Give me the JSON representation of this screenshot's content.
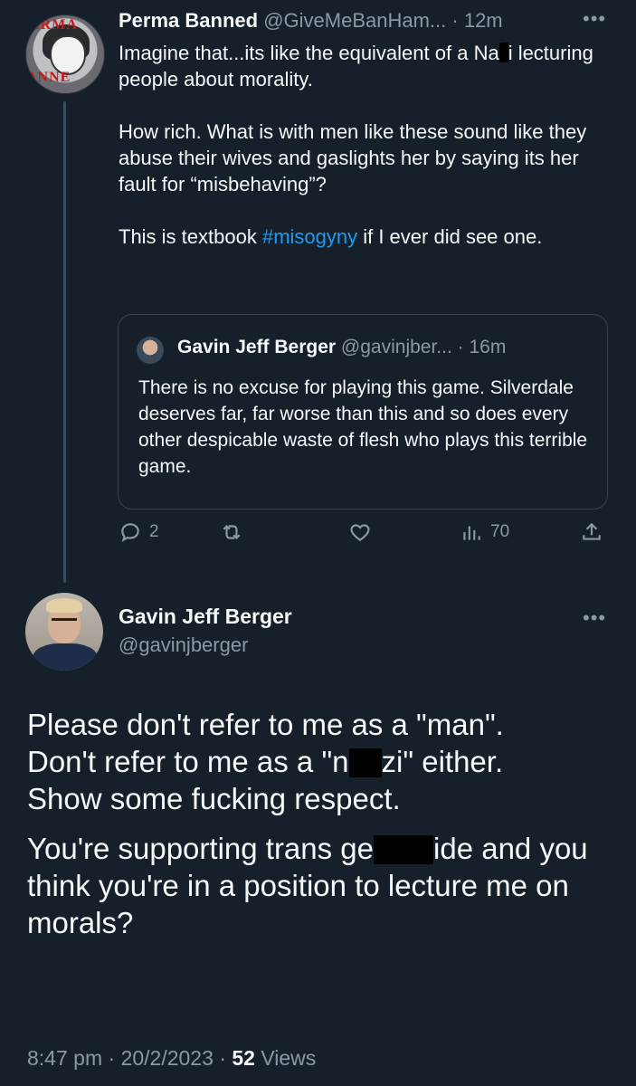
{
  "parent_tweet": {
    "display_name": "Perma Banned",
    "handle": "@GiveMeBanHam...",
    "separator": "·",
    "time": "12m",
    "more_icon": "more-horizontal-icon",
    "avatar_banner_top": "ERMA",
    "avatar_banner_bottom": "ANNE",
    "text_p1_before": "Imagine that...its like the equivalent of a Na",
    "text_p1_after": "i lecturing people about morality.",
    "text_p2": "How rich. What is with men like these sound like they abuse their wives and gaslights her by saying its her fault for “misbehaving”?",
    "text_p3_before": "This is textbook ",
    "hashtag": "#misogyny",
    "text_p3_after": " if I ever did see one."
  },
  "quoted_tweet": {
    "display_name": "Gavin Jeff Berger",
    "handle": "@gavinjber...",
    "separator": "·",
    "time": "16m",
    "text": "There is no excuse for playing this game. Silverdale deserves far, far worse than this and so does every other despicable waste of flesh who plays this terrible game."
  },
  "actions": {
    "reply_count": "2",
    "retweet_count": "",
    "like_count": "",
    "views_count": "70"
  },
  "main_tweet": {
    "display_name": "Gavin Jeff Berger",
    "handle": "@gavinjberger",
    "p1_line1": "Please don't refer to me as a \"man\".",
    "p1_line2_before": "Don't refer to me as a \"n",
    "p1_line2_after": "zi\" either.",
    "p1_line3": "Show some fucking respect.",
    "p2_before": "You're supporting trans ge",
    "p2_after": "ide and you think you're in a position to lecture me on morals?",
    "time": "8:47 pm",
    "date": "20/2/2023",
    "separator": "·",
    "views_count": "52",
    "views_label": "Views"
  },
  "colors": {
    "background": "#15202b",
    "text": "#f7f9f9",
    "muted": "#8b98a5",
    "link": "#1d9bf0",
    "border": "#38444d"
  }
}
